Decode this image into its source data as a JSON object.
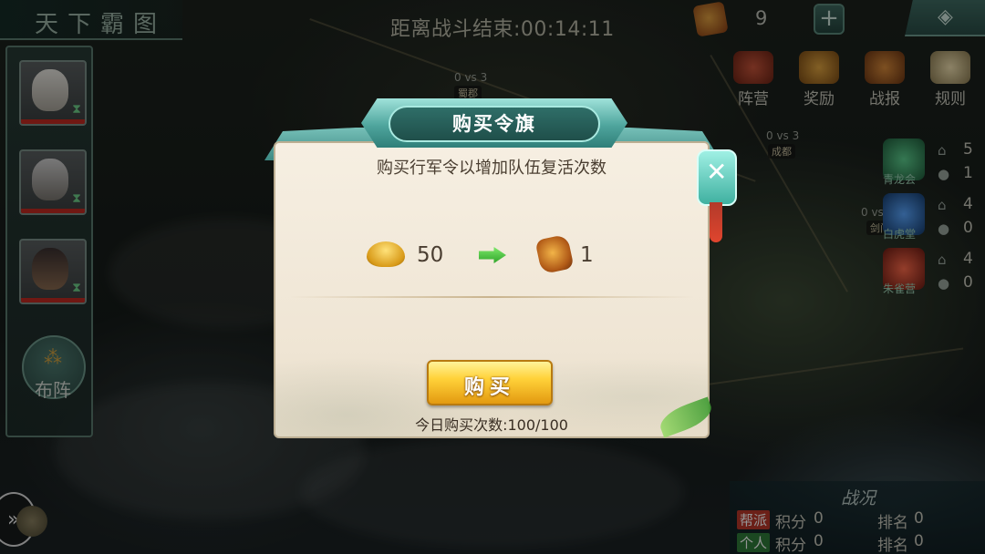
{
  "header": {
    "game_title": "天下霸图",
    "countdown": "距离战斗结束:00:14:11"
  },
  "resources": {
    "token_count": "9",
    "add_symbol": "+",
    "corner_menu_icon": "diamond-menu-icon"
  },
  "top_menu": [
    {
      "label": "阵营",
      "icon": "camp-banner-icon",
      "color": "#b7412c"
    },
    {
      "label": "奖励",
      "icon": "reward-pouch-icon",
      "color": "#c8872a"
    },
    {
      "label": "战报",
      "icon": "battle-report-icon",
      "color": "#b8652a"
    },
    {
      "label": "规则",
      "icon": "scroll-rules-icon",
      "color": "#d8c69a"
    }
  ],
  "sidebar": {
    "heroes": [
      {
        "name": "hero-1",
        "icon": "white-haired-elder-portrait"
      },
      {
        "name": "hero-2",
        "icon": "grey-haired-warrior-portrait"
      },
      {
        "name": "hero-3",
        "icon": "bearded-general-portrait"
      }
    ],
    "formation_label": "布阵"
  },
  "map": {
    "labels": [
      "0 vs 3",
      "0 vs 3",
      "0 vs"
    ],
    "cities": [
      "蜀郡",
      "成都",
      "剑门"
    ]
  },
  "camps": [
    {
      "name": "青龙会",
      "count_a": "5",
      "count_b": "1",
      "color": "#3fae74"
    },
    {
      "name": "白虎堂",
      "count_a": "4",
      "count_b": "0",
      "color": "#2f7fc8"
    },
    {
      "name": "朱雀营",
      "count_a": "4",
      "count_b": "0",
      "color": "#c23a2a"
    }
  ],
  "battle_panel": {
    "title": "战况",
    "faction_tag": "帮派",
    "personal_tag": "个人",
    "score_label": "积分",
    "rank_label": "排名",
    "faction_score": "0",
    "faction_rank": "0",
    "personal_score": "0",
    "personal_rank": "0"
  },
  "dialog": {
    "title": "购买令旗",
    "message": "购买行军令以增加队伍复活次数",
    "cost_amount": "50",
    "cost_icon": "gold-ingot-icon",
    "reward_amount": "1",
    "reward_icon": "command-token-icon",
    "buy_label": "购买",
    "daily_count": "今日购买次数:100/100",
    "close_icon": "close-icon"
  }
}
